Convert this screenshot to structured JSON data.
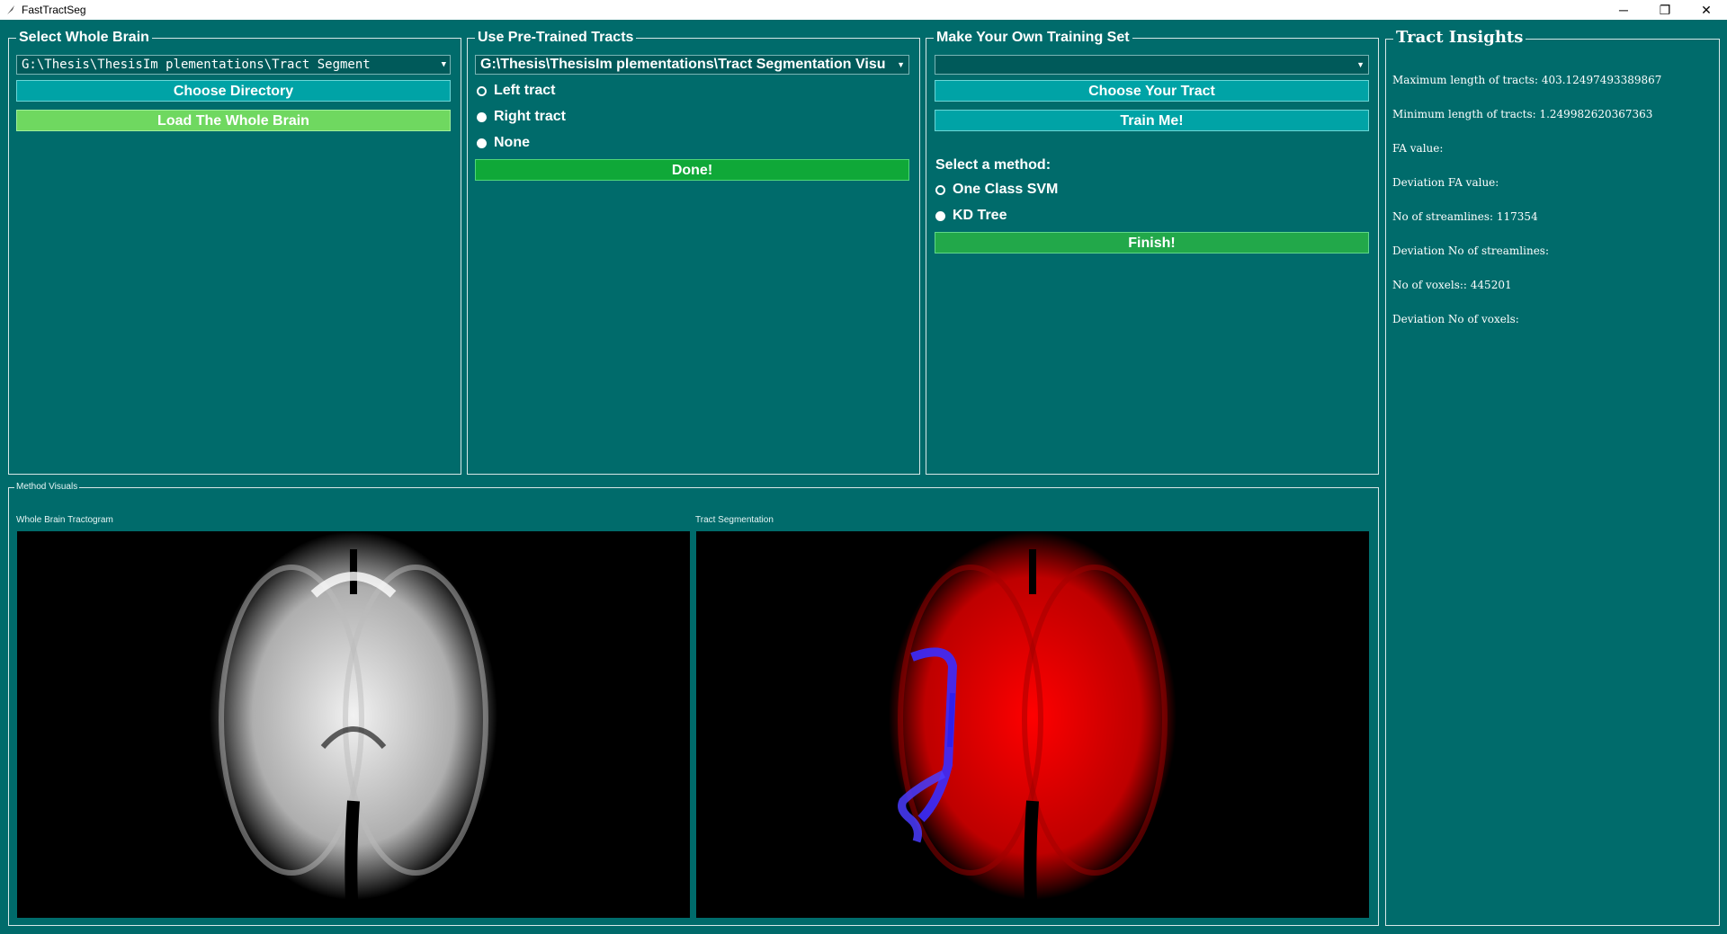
{
  "window": {
    "title": "FastTractSeg",
    "controls": {
      "minimize": "─",
      "restore": "❐",
      "close": "✕"
    }
  },
  "select_whole_brain": {
    "title": "Select Whole Brain",
    "path_value": "G:\\Thesis\\ThesisIm plementations\\Tract Segment",
    "choose_directory_label": "Choose Directory",
    "load_label": "Load The Whole Brain"
  },
  "pretrained": {
    "title": "Use Pre-Trained Tracts",
    "path_value": "G:\\Thesis\\ThesisIm plementations\\Tract Segmentation Visu",
    "options": [
      {
        "label": "Left tract",
        "selected": false
      },
      {
        "label": "Right tract",
        "selected": true
      },
      {
        "label": "None",
        "selected": true
      }
    ],
    "done_label": "Done!"
  },
  "training": {
    "title": "Make Your Own Training Set",
    "tract_value": "",
    "choose_tract_label": "Choose Your Tract",
    "train_label": "Train Me!",
    "method_label": "Select a method:",
    "methods": [
      {
        "label": "One Class SVM",
        "selected": false
      },
      {
        "label": "KD Tree",
        "selected": true
      }
    ],
    "finish_label": "Finish!"
  },
  "insights": {
    "title": "Tract Insights",
    "lines": [
      "Maximum length of tracts: 403.12497493389867",
      "Minimum length of tracts: 1.249982620367363",
      "FA value:",
      "Deviation FA value:",
      "No of streamlines: 117354",
      "Deviation No of streamlines:",
      "No of voxels:: 445201",
      "Deviation No of voxels:"
    ]
  },
  "visuals": {
    "title": "Method Visuals",
    "left_label": "Whole Brain Tractogram",
    "right_label": "Tract Segmentation"
  },
  "colors": {
    "background": "#006b6b",
    "button_teal": "#00a3a6",
    "button_lightgreen": "#6fd860",
    "button_green": "#0fa838",
    "tract_main": "#ff0000",
    "tract_segment": "#3a2cff"
  }
}
